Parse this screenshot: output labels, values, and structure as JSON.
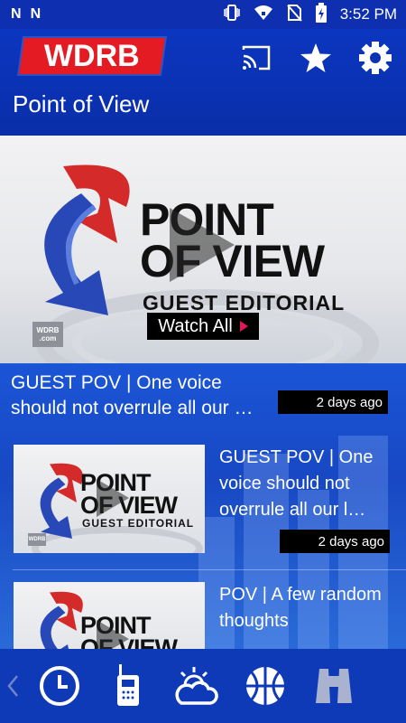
{
  "status_bar": {
    "left_icons": [
      "N",
      "N"
    ],
    "time": "3:52 PM",
    "right_icons": [
      "vibrate-icon",
      "wifi-icon",
      "no-sim-icon",
      "battery-charging-icon"
    ]
  },
  "header": {
    "logo_text": "WDRB",
    "page_title": "Point of View",
    "icons": [
      "cast-icon",
      "star-icon",
      "gear-icon"
    ]
  },
  "hero": {
    "artwork_title_line1": "POINT",
    "artwork_title_line2": "OF VIEW",
    "artwork_subtitle": "GUEST EDITORIAL",
    "small_logo_line1": "WDRB",
    "small_logo_line2": ".com",
    "watch_all_label": "Watch All"
  },
  "featured": {
    "title": "GUEST POV | One voice should not overrule all our …",
    "time_ago": "2 days ago"
  },
  "items": [
    {
      "title": "GUEST POV | One voice should not overrule all our l…",
      "time_ago": "2 days ago",
      "thumb_title_line1": "POINT",
      "thumb_title_line2": "OF VIEW",
      "thumb_subtitle": "GUEST EDITORIAL",
      "thumb_logo": "WDRB"
    },
    {
      "title": "POV | A few random thoughts",
      "thumb_title_line1": "POINT",
      "thumb_title_line2": "OF VIEW"
    }
  ],
  "bottom_nav": {
    "items": [
      "clock-icon",
      "walkie-talkie-icon",
      "weather-icon",
      "basketball-icon",
      "binoculars-icon"
    ]
  },
  "colors": {
    "brand_red": "#e41b23",
    "header_blue": "#0b36c0",
    "content_blue": "#1a55d6",
    "play_accent": "#e0175c"
  }
}
